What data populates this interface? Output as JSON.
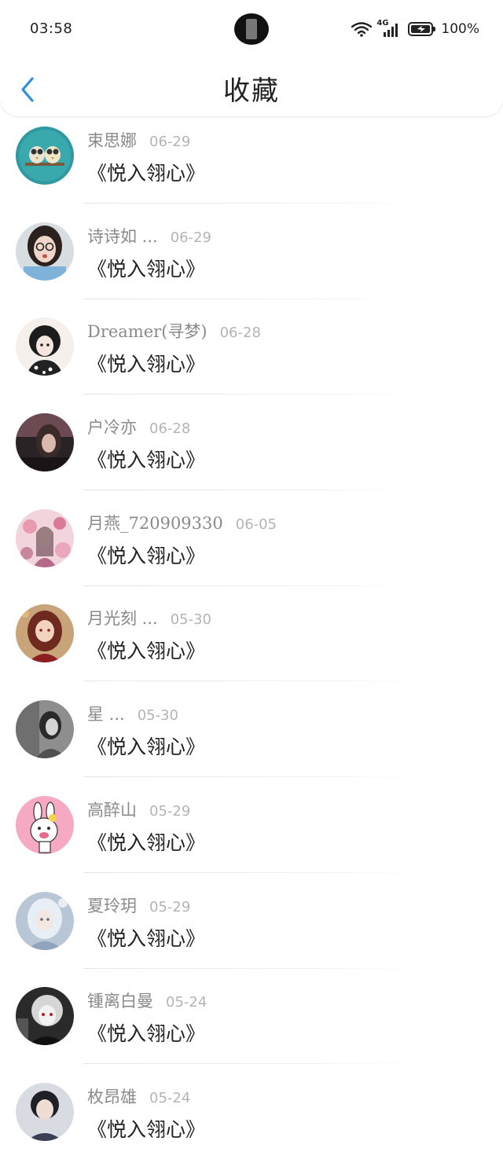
{
  "status_bar": {
    "time": "03:58",
    "network": "4G",
    "battery": "100%"
  },
  "header": {
    "title": "收藏",
    "back_icon": "chevron-left-icon",
    "accent_color": "#2f8fe0"
  },
  "favorites": [
    {
      "user": "束思娜",
      "date": "06-29",
      "title": "《悦入翎心》",
      "avatar": "owls-avatar"
    },
    {
      "user": "诗诗如 ...",
      "date": "06-29",
      "title": "《悦入翎心》",
      "avatar": "girl-glasses-avatar"
    },
    {
      "user": "Dreamer(寻梦)",
      "date": "06-28",
      "title": "《悦入翎心》",
      "avatar": "anime-girl-bw-avatar"
    },
    {
      "user": "户冷亦",
      "date": "06-28",
      "title": "《悦入翎心》",
      "avatar": "dark-girl-avatar"
    },
    {
      "user": "月燕_720909330",
      "date": "06-05",
      "title": "《悦入翎心》",
      "avatar": "pink-flowers-avatar"
    },
    {
      "user": "月光刻 ...",
      "date": "05-30",
      "title": "《悦入翎心》",
      "avatar": "red-hair-girl-avatar"
    },
    {
      "user": "星 ...",
      "date": "05-30",
      "title": "《悦入翎心》",
      "avatar": "grey-girl-avatar"
    },
    {
      "user": "高醉山",
      "date": "05-29",
      "title": "《悦入翎心》",
      "avatar": "cartoon-bunny-avatar"
    },
    {
      "user": "夏玲玥",
      "date": "05-29",
      "title": "《悦入翎心》",
      "avatar": "white-hair-girl-avatar"
    },
    {
      "user": "锺离白曼",
      "date": "05-24",
      "title": "《悦入翎心》",
      "avatar": "silver-hair-boy-avatar"
    },
    {
      "user": "枚昂雄",
      "date": "05-24",
      "title": "《悦入翎心》",
      "avatar": "boy-portrait-avatar"
    }
  ]
}
